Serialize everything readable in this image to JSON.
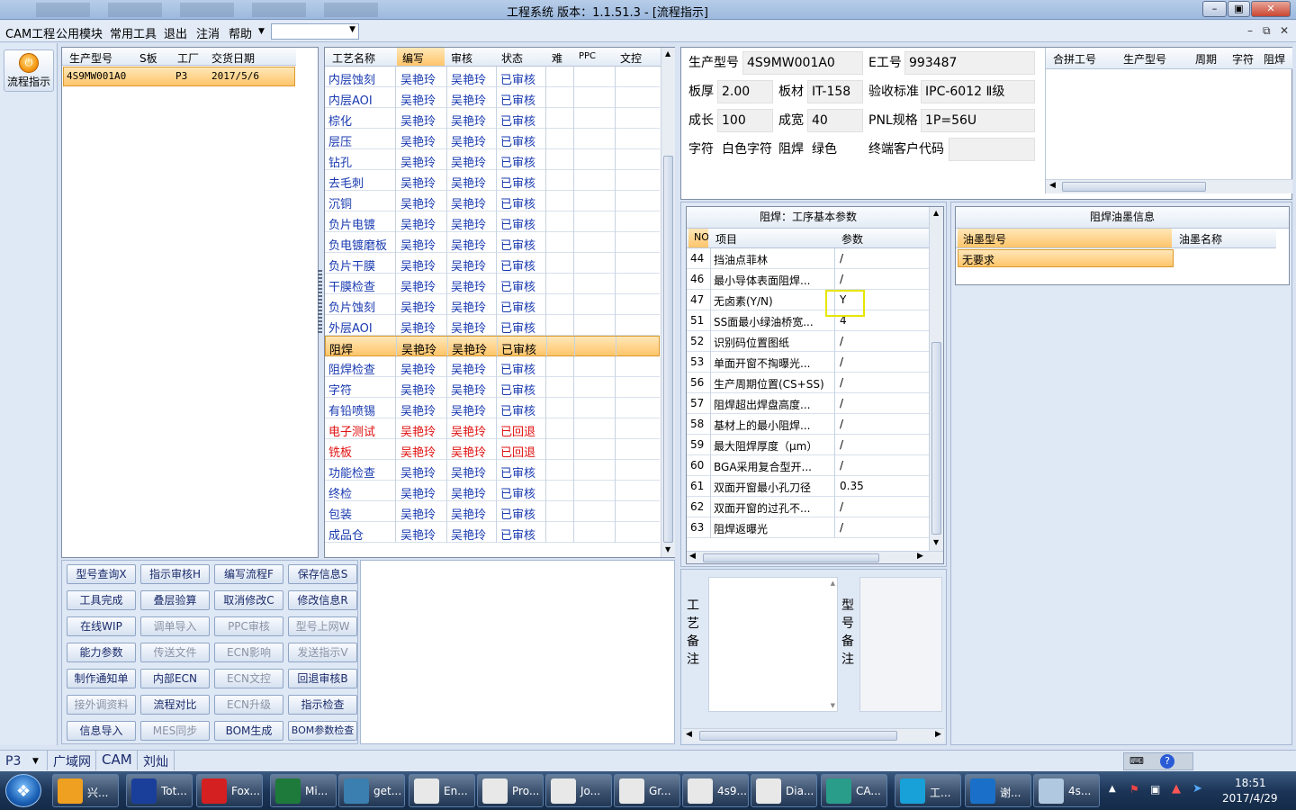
{
  "window": {
    "title": "工程系统   版本：1.1.51.3 - [流程指示]"
  },
  "menu": {
    "items": [
      "CAM工程",
      "公用模块",
      "常用工具",
      "退出",
      "注消",
      "帮助"
    ],
    "combo_value": ""
  },
  "left_strip": {
    "flow_button_label": "流程指示"
  },
  "order_grid": {
    "headers": [
      "生产型号",
      "S板",
      "工厂",
      "交货日期"
    ],
    "rows": [
      {
        "model": "4S9MW001A0",
        "s": "",
        "factory": "P3",
        "date": "2017/5/6"
      }
    ]
  },
  "process_grid": {
    "headers": [
      "工艺名称",
      "编写",
      "审核",
      "状态",
      "难",
      "PPC",
      "文控"
    ],
    "rows": [
      {
        "name": "内层蚀刻",
        "writer": "吴艳玲",
        "reviewer": "吴艳玲",
        "status": "已审核",
        "color": "blue"
      },
      {
        "name": "内层AOI",
        "writer": "吴艳玲",
        "reviewer": "吴艳玲",
        "status": "已审核",
        "color": "blue"
      },
      {
        "name": "棕化",
        "writer": "吴艳玲",
        "reviewer": "吴艳玲",
        "status": "已审核",
        "color": "blue"
      },
      {
        "name": "层压",
        "writer": "吴艳玲",
        "reviewer": "吴艳玲",
        "status": "已审核",
        "color": "blue"
      },
      {
        "name": "钻孔",
        "writer": "吴艳玲",
        "reviewer": "吴艳玲",
        "status": "已审核",
        "color": "blue"
      },
      {
        "name": "去毛刺",
        "writer": "吴艳玲",
        "reviewer": "吴艳玲",
        "status": "已审核",
        "color": "blue"
      },
      {
        "name": "沉铜",
        "writer": "吴艳玲",
        "reviewer": "吴艳玲",
        "status": "已审核",
        "color": "blue"
      },
      {
        "name": "负片电镀",
        "writer": "吴艳玲",
        "reviewer": "吴艳玲",
        "status": "已审核",
        "color": "blue"
      },
      {
        "name": "负电镀磨板",
        "writer": "吴艳玲",
        "reviewer": "吴艳玲",
        "status": "已审核",
        "color": "blue"
      },
      {
        "name": "负片干膜",
        "writer": "吴艳玲",
        "reviewer": "吴艳玲",
        "status": "已审核",
        "color": "blue"
      },
      {
        "name": "干膜检查",
        "writer": "吴艳玲",
        "reviewer": "吴艳玲",
        "status": "已审核",
        "color": "blue"
      },
      {
        "name": "负片蚀刻",
        "writer": "吴艳玲",
        "reviewer": "吴艳玲",
        "status": "已审核",
        "color": "blue"
      },
      {
        "name": "外层AOI",
        "writer": "吴艳玲",
        "reviewer": "吴艳玲",
        "status": "已审核",
        "color": "blue"
      },
      {
        "name": "阻焊",
        "writer": "吴艳玲",
        "reviewer": "吴艳玲",
        "status": "已审核",
        "color": "sel"
      },
      {
        "name": "阻焊检查",
        "writer": "吴艳玲",
        "reviewer": "吴艳玲",
        "status": "已审核",
        "color": "blue"
      },
      {
        "name": "字符",
        "writer": "吴艳玲",
        "reviewer": "吴艳玲",
        "status": "已审核",
        "color": "blue"
      },
      {
        "name": "有铅喷锡",
        "writer": "吴艳玲",
        "reviewer": "吴艳玲",
        "status": "已审核",
        "color": "blue"
      },
      {
        "name": "电子测试",
        "writer": "吴艳玲",
        "reviewer": "吴艳玲",
        "status": "已回退",
        "color": "red"
      },
      {
        "name": "铣板",
        "writer": "吴艳玲",
        "reviewer": "吴艳玲",
        "status": "已回退",
        "color": "red"
      },
      {
        "name": "功能检查",
        "writer": "吴艳玲",
        "reviewer": "吴艳玲",
        "status": "已审核",
        "color": "blue"
      },
      {
        "name": "终检",
        "writer": "吴艳玲",
        "reviewer": "吴艳玲",
        "status": "已审核",
        "color": "blue"
      },
      {
        "name": "包装",
        "writer": "吴艳玲",
        "reviewer": "吴艳玲",
        "status": "已审核",
        "color": "blue"
      },
      {
        "name": "成品仓",
        "writer": "吴艳玲",
        "reviewer": "吴艳玲",
        "status": "已审核",
        "color": "blue"
      }
    ]
  },
  "buttons": [
    {
      "label": "型号查询X",
      "enabled": true
    },
    {
      "label": "指示审核H",
      "enabled": true
    },
    {
      "label": "编写流程F",
      "enabled": true
    },
    {
      "label": "保存信息S",
      "enabled": true
    },
    {
      "label": "工具完成",
      "enabled": true
    },
    {
      "label": "叠层验算",
      "enabled": true
    },
    {
      "label": "取消修改C",
      "enabled": true
    },
    {
      "label": "修改信息R",
      "enabled": true
    },
    {
      "label": "在线WIP",
      "enabled": true
    },
    {
      "label": "调单导入",
      "enabled": false
    },
    {
      "label": "PPC审核",
      "enabled": false
    },
    {
      "label": "型号上网W",
      "enabled": false
    },
    {
      "label": "能力参数",
      "enabled": true
    },
    {
      "label": "传送文件",
      "enabled": false
    },
    {
      "label": "ECN影响",
      "enabled": false
    },
    {
      "label": "发送指示V",
      "enabled": false
    },
    {
      "label": "制作通知单",
      "enabled": true
    },
    {
      "label": "内部ECN",
      "enabled": true
    },
    {
      "label": "ECN文控",
      "enabled": false
    },
    {
      "label": "回退审核B",
      "enabled": true
    },
    {
      "label": "接外调资料",
      "enabled": false
    },
    {
      "label": "流程对比",
      "enabled": true
    },
    {
      "label": "ECN升级",
      "enabled": false
    },
    {
      "label": "指示检查",
      "enabled": true
    },
    {
      "label": "信息导入",
      "enabled": true
    },
    {
      "label": "MES同步",
      "enabled": false
    },
    {
      "label": "BOM生成",
      "enabled": true
    },
    {
      "label": "BOM参数检查",
      "enabled": true
    }
  ],
  "product_info": {
    "model_label": "生产型号",
    "model": "4S9MW001A0",
    "e_label": "E工号",
    "e_no": "993487",
    "thickness_label": "板厚",
    "thickness": "2.00",
    "material_label": "板材",
    "material": "IT-158",
    "accept_label": "验收标准",
    "accept": "IPC-6012 Ⅱ级",
    "length_label": "成长",
    "length": "100",
    "width_label": "成宽",
    "width": "40",
    "pnl_label": "PNL规格",
    "pnl": "1P=56U",
    "char_label": "字符",
    "char": "白色字符",
    "mask_label": "阻焊",
    "mask": "绿色",
    "customer_label": "终端客户代码",
    "customer": ""
  },
  "merge_grid": {
    "headers": [
      "合拼工号",
      "生产型号",
      "周期",
      "字符",
      "阻焊"
    ]
  },
  "params": {
    "title": "阻焊：工序基本参数",
    "headers": [
      "NO",
      "项目",
      "参数"
    ],
    "rows": [
      {
        "no": "44",
        "item": "挡油点菲林",
        "value": "/"
      },
      {
        "no": "46",
        "item": "最小导体表面阻焊...",
        "value": "/"
      },
      {
        "no": "47",
        "item": "无卤素(Y/N)",
        "value": "Y"
      },
      {
        "no": "51",
        "item": "SS面最小绿油桥宽...",
        "value": "4"
      },
      {
        "no": "52",
        "item": "识别码位置图纸",
        "value": "/"
      },
      {
        "no": "53",
        "item": "单面开窗不掏曝光...",
        "value": "/"
      },
      {
        "no": "56",
        "item": "生产周期位置(CS+SS)",
        "value": "/"
      },
      {
        "no": "57",
        "item": "阻焊超出焊盘高度...",
        "value": "/"
      },
      {
        "no": "58",
        "item": "基材上的最小阻焊...",
        "value": "/"
      },
      {
        "no": "59",
        "item": "最大阻焊厚度（μm）",
        "value": "/"
      },
      {
        "no": "60",
        "item": "BGA采用复合型开...",
        "value": "/"
      },
      {
        "no": "61",
        "item": "双面开窗最小孔刀径",
        "value": "0.35"
      },
      {
        "no": "62",
        "item": "双面开窗的过孔不...",
        "value": "/"
      },
      {
        "no": "63",
        "item": "阻焊返曝光",
        "value": "/"
      }
    ]
  },
  "ink_info": {
    "title": "阻焊油墨信息",
    "headers": [
      "油墨型号",
      "油墨名称"
    ],
    "rows": [
      {
        "model": "无要求",
        "name": ""
      }
    ]
  },
  "notes": {
    "process_label": "工艺备注",
    "model_label": "型号备注"
  },
  "statusbar": {
    "factory": "P3",
    "items": [
      "广域网",
      "CAM",
      "刘灿"
    ]
  },
  "taskbar": {
    "tasks": [
      "兴...",
      "Tot...",
      "Fox...",
      "Mi...",
      "get...",
      "En...",
      "Pro...",
      "Jo...",
      "Gr...",
      "4s9...",
      "Dia...",
      "CA...",
      "工...",
      "谢...",
      "4s..."
    ],
    "time": "18:51",
    "date": "2017/4/29"
  },
  "colors": {
    "accent_selection": "#ffc56a",
    "link_blue": "#1a3bb0",
    "returned_red": "#e01010",
    "highlight_box": "#e6e600"
  }
}
